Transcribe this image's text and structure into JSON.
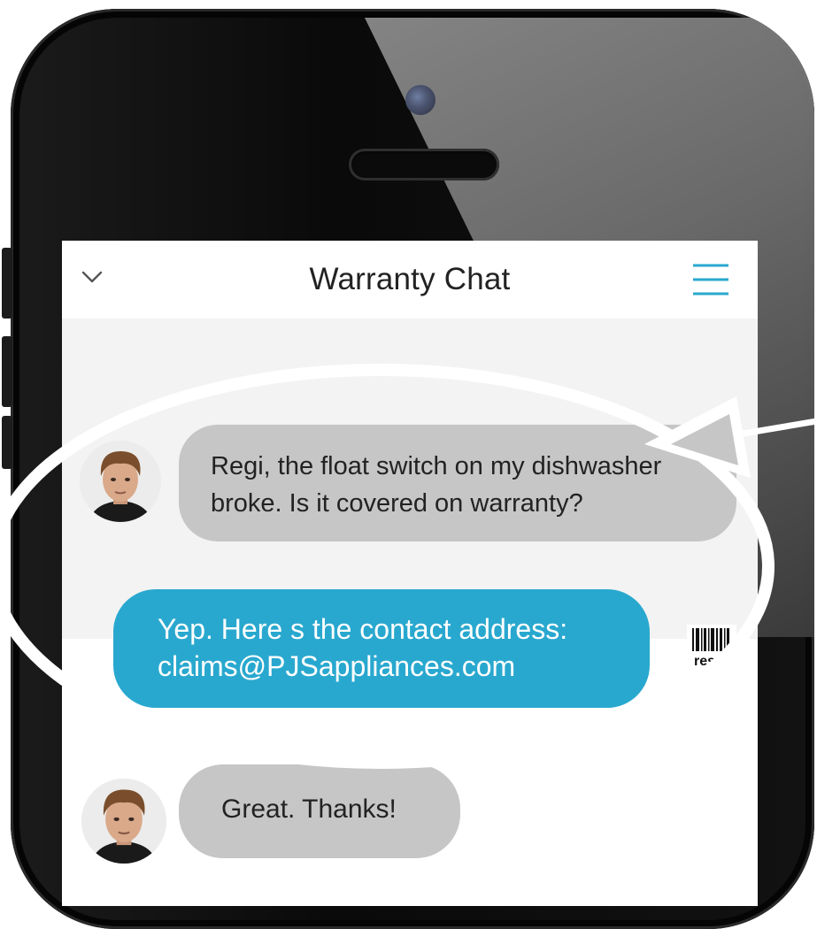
{
  "header": {
    "title": "Warranty Chat",
    "accent_color": "#29a8cf",
    "back_icon": "chevron-down-icon",
    "menu_icon": "hamburger-menu-icon"
  },
  "messages": [
    {
      "sender": "user",
      "lines": [
        "Regi, the float switch on my dishwasher",
        "broke. Is it covered on warranty?"
      ]
    },
    {
      "sender": "bot",
      "lines": [
        "Yep.  Here s the contact address:",
        "claims@PJSappliances.com"
      ]
    },
    {
      "sender": "user",
      "lines": [
        "Great. Thanks!"
      ]
    }
  ],
  "bot_avatar": {
    "icon": "barcode-icon",
    "text": "res"
  },
  "colors": {
    "user_bubble": "#c6c6c6",
    "bot_bubble": "#29a8cf",
    "highlight_ring": "#ffffff"
  }
}
